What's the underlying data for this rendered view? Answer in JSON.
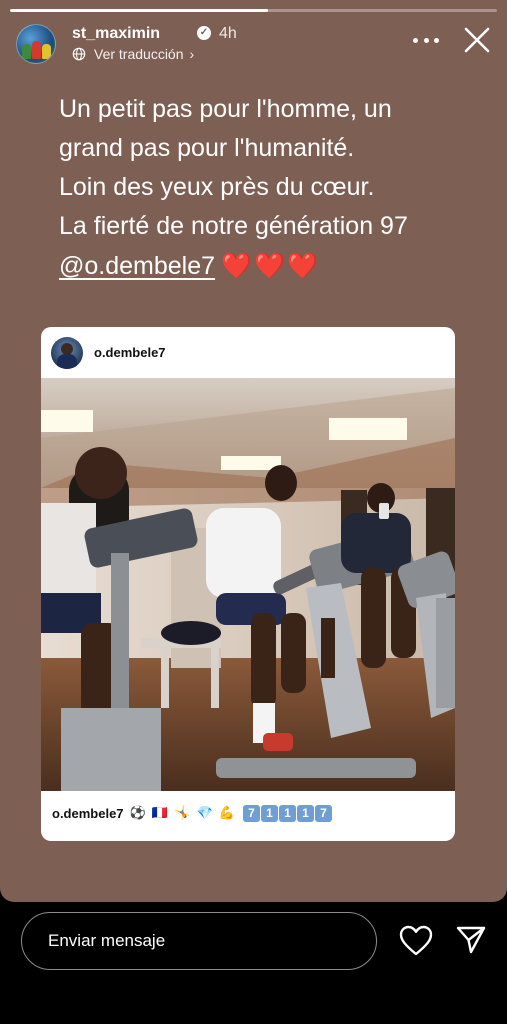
{
  "story": {
    "progress": 0.53,
    "header": {
      "username": "st_maximin",
      "time": "4h",
      "translate_label": "Ver traducción"
    },
    "caption_lines": [
      "Un petit pas pour l'homme, un",
      "grand pas pour l'humanité.",
      "Loin des yeux près du cœur.",
      "La fierté de notre génération 97"
    ],
    "mention": "@o.dembele7",
    "hearts": "❤️❤️❤️",
    "shared_post": {
      "username": "o.dembele7",
      "caption_user": "o.dembele7",
      "caption_emojis": "⚽ 🇫🇷 🤸 💎 💪",
      "caption_digits": [
        "7",
        "1",
        "1",
        "1",
        "7"
      ]
    }
  },
  "reply": {
    "placeholder": "Enviar mensaje"
  },
  "colors": {
    "story_background": "#7d5f54",
    "heart_red": "#e8202a",
    "digit_box": "#6e9ed3"
  }
}
